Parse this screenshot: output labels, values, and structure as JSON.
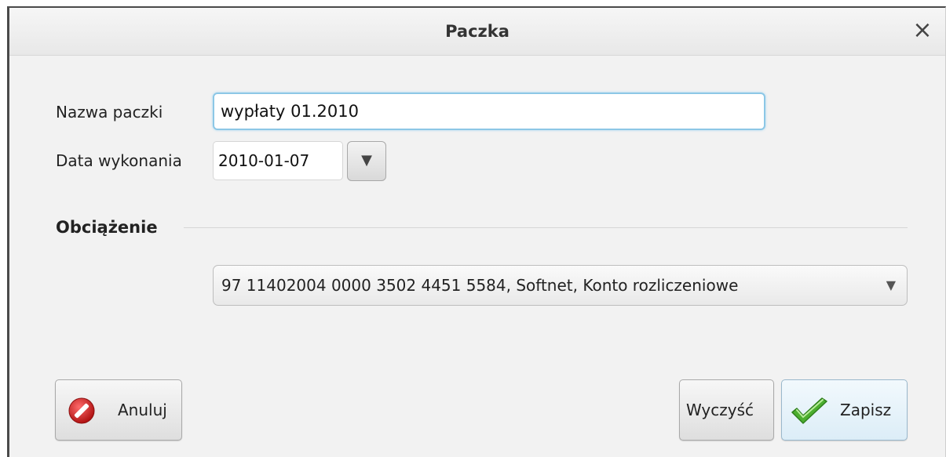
{
  "dialog": {
    "title": "Paczka",
    "close_icon": "close-icon"
  },
  "form": {
    "name_label": "Nazwa paczki",
    "name_value": "wypłaty 01.2010",
    "date_label": "Data wykonania",
    "date_value": "2010-01-07",
    "date_dropdown_icon": "triangle-down-icon"
  },
  "section": {
    "title": "Obciążenie",
    "account_value": "97 11402004 0000 3502 4451 5584, Softnet, Konto rozliczeniowe",
    "account_dropdown_icon": "chevron-down-icon"
  },
  "buttons": {
    "cancel_label": "Anuluj",
    "cancel_icon": "no-entry-icon",
    "clear_label": "Wyczyść",
    "save_label": "Zapisz",
    "save_icon": "checkmark-icon"
  },
  "colors": {
    "focus_border": "#8cc7e6",
    "cancel_icon_red": "#d32121",
    "save_icon_green": "#4cae2f"
  }
}
